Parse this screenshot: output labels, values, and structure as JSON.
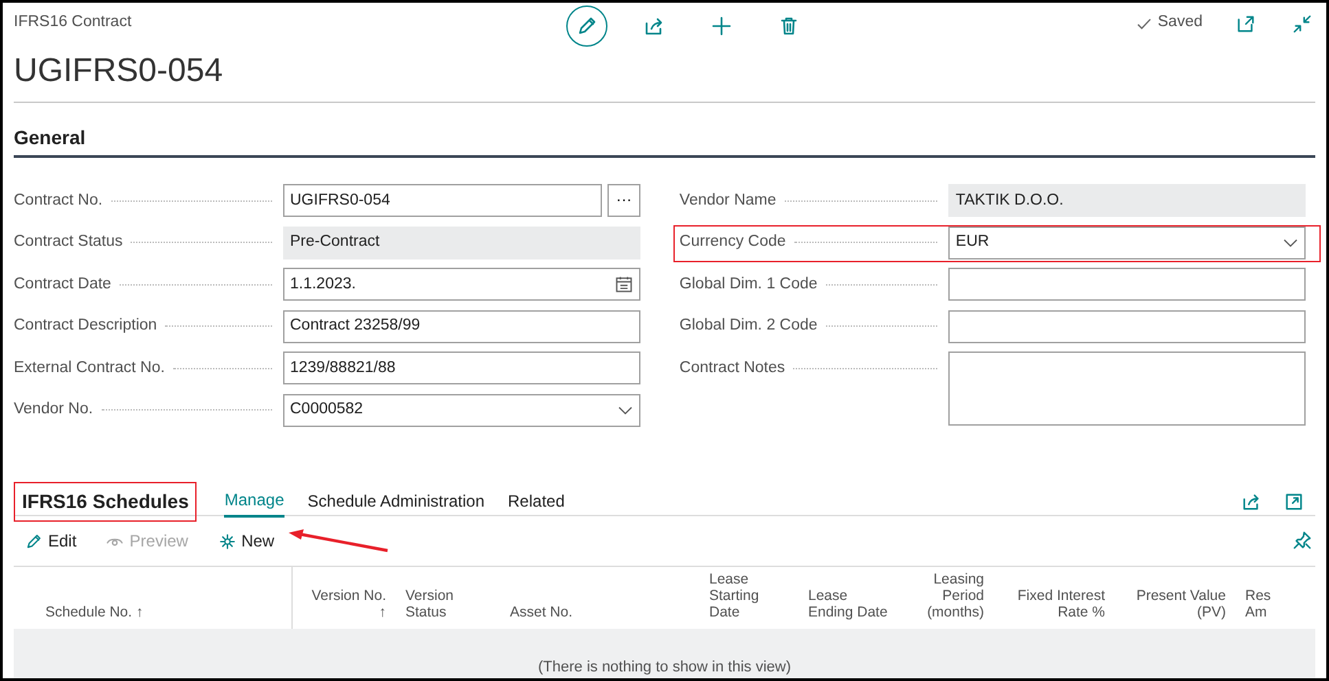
{
  "header": {
    "page_type": "IFRS16 Contract",
    "record_title": "UGIFRS0-054",
    "status": "Saved"
  },
  "general": {
    "title": "General",
    "left_fields": [
      {
        "label": "Contract No.",
        "value": "UGIFRS0-054",
        "kind": "lookup",
        "button": "···",
        "highlighted": false
      },
      {
        "label": "Contract Status",
        "value": "Pre-Contract",
        "kind": "readonly",
        "highlighted": false
      },
      {
        "label": "Contract Date",
        "value": "1.1.2023.",
        "kind": "date",
        "highlighted": false
      },
      {
        "label": "Contract Description",
        "value": "Contract 23258/99",
        "kind": "text",
        "highlighted": false
      },
      {
        "label": "External Contract No.",
        "value": "1239/88821/88",
        "kind": "text",
        "highlighted": false
      },
      {
        "label": "Vendor No.",
        "value": "C0000582",
        "kind": "dropdown",
        "highlighted": false
      }
    ],
    "right_fields": [
      {
        "label": "Vendor Name",
        "value": "TAKTIK D.O.O.",
        "kind": "readonly",
        "highlighted": false
      },
      {
        "label": "Currency Code",
        "value": "EUR",
        "kind": "dropdown",
        "highlighted": true
      },
      {
        "label": "Global Dim. 1 Code",
        "kind": "text",
        "highlighted": false
      },
      {
        "label": "Global Dim. 2 Code",
        "kind": "text",
        "highlighted": false
      },
      {
        "label": "Contract Notes",
        "kind": "textarea",
        "highlighted": false
      }
    ]
  },
  "schedules": {
    "title": "IFRS16 Schedules",
    "title_highlighted": true,
    "tabs": [
      {
        "label": "Manage",
        "selected": true
      },
      {
        "label": "Schedule Administration",
        "selected": false
      },
      {
        "label": "Related",
        "selected": false
      }
    ],
    "actions": [
      {
        "label": "Edit",
        "kind": "edit",
        "disabled": false,
        "annotated": false
      },
      {
        "label": "Preview",
        "kind": "preview",
        "disabled": true,
        "annotated": false
      },
      {
        "label": "New",
        "kind": "new",
        "disabled": false,
        "annotated": true
      }
    ],
    "columns": [
      "Schedule No. ↑",
      "Version No.\n↑",
      "Version\nStatus",
      "Asset No.",
      "Lease\nStarting\nDate",
      "Lease\nEnding Date",
      "Leasing\nPeriod\n(months)",
      "Fixed Interest\nRate %",
      "Present Value\n(PV)",
      "Res\nAm"
    ],
    "empty_message": "(There is nothing to show in this view)"
  }
}
